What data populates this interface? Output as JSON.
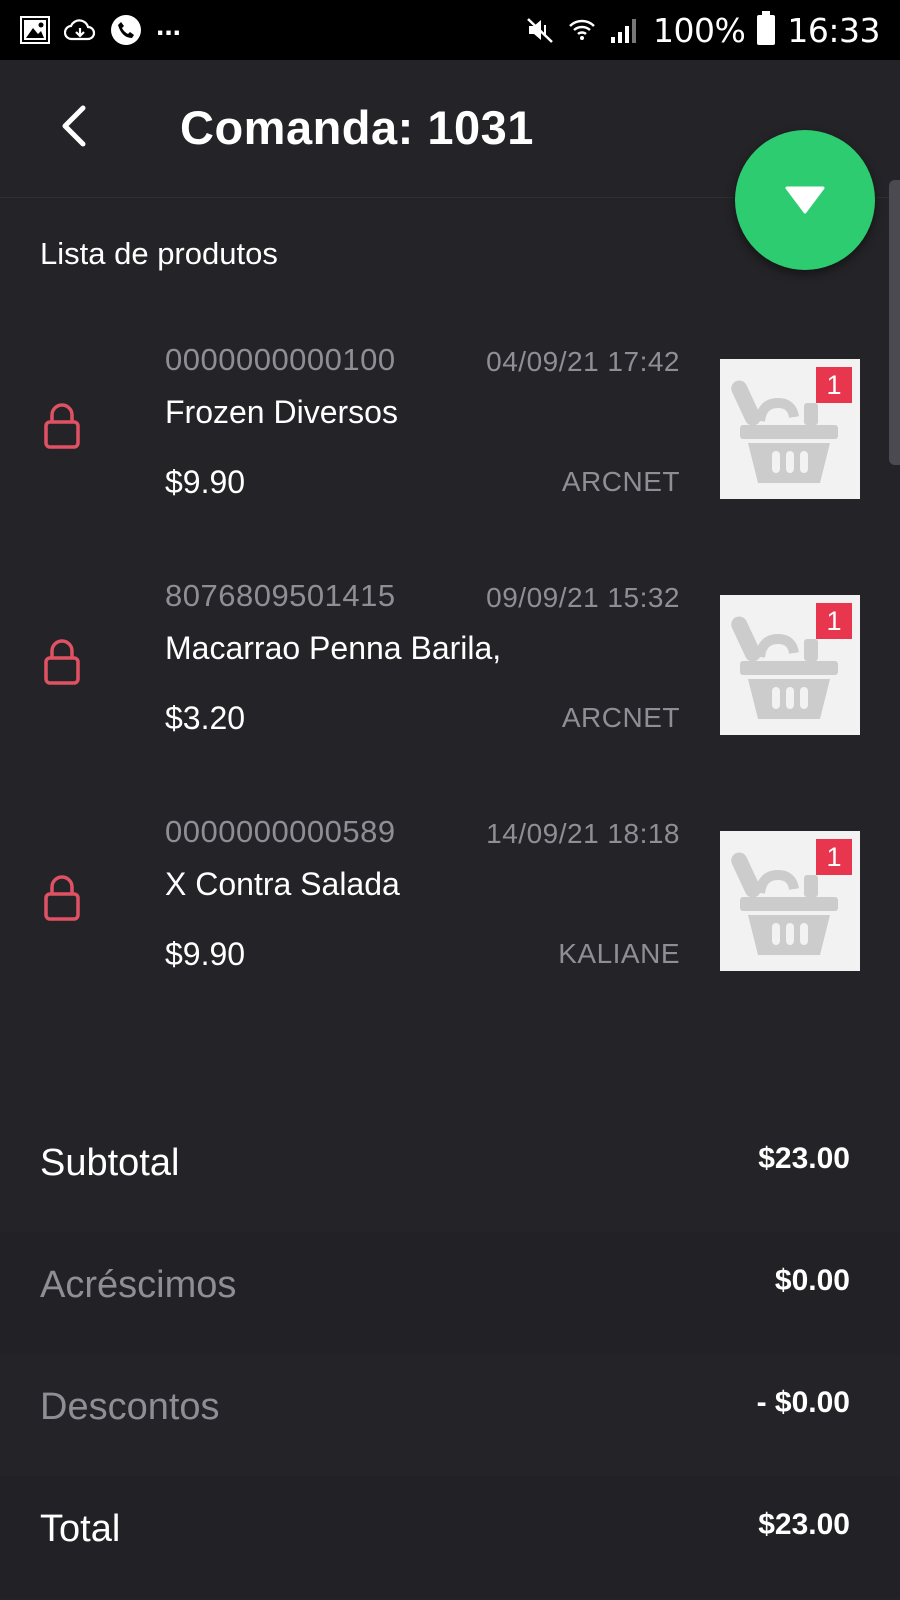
{
  "status_bar": {
    "battery": "100%",
    "time": "16:33",
    "more": "..."
  },
  "header": {
    "title": "Comanda: 1031"
  },
  "section_title": "Lista de produtos",
  "products": [
    {
      "code": "0000000000100",
      "date": "04/09/21 17:42",
      "name": "Frozen Diversos",
      "price": "$9.90",
      "user": "ARCNET",
      "qty": "1"
    },
    {
      "code": "8076809501415",
      "date": "09/09/21 15:32",
      "name": "Macarrao Penna Barila,",
      "price": "$3.20",
      "user": "ARCNET",
      "qty": "1"
    },
    {
      "code": "0000000000589",
      "date": "14/09/21 18:18",
      "name": "X Contra Salada",
      "price": "$9.90",
      "user": "KALIANE",
      "qty": "1"
    }
  ],
  "summary": {
    "subtotal_label": "Subtotal",
    "subtotal_value": "$23.00",
    "additions_label": "Acréscimos",
    "additions_value": "$0.00",
    "discounts_label": "Descontos",
    "discounts_value": "- $0.00",
    "total_label": "Total",
    "total_value": "$23.00"
  },
  "colors": {
    "background": "#242428",
    "fab": "#2ecc71",
    "lock": "#e05263",
    "badge": "#e8364f",
    "muted_text": "#8e8e94"
  },
  "icons": {
    "back": "chevron-left-icon",
    "fab": "triangle-down-icon",
    "lock": "lock-icon",
    "product_image": "shopping-basket-icon"
  }
}
